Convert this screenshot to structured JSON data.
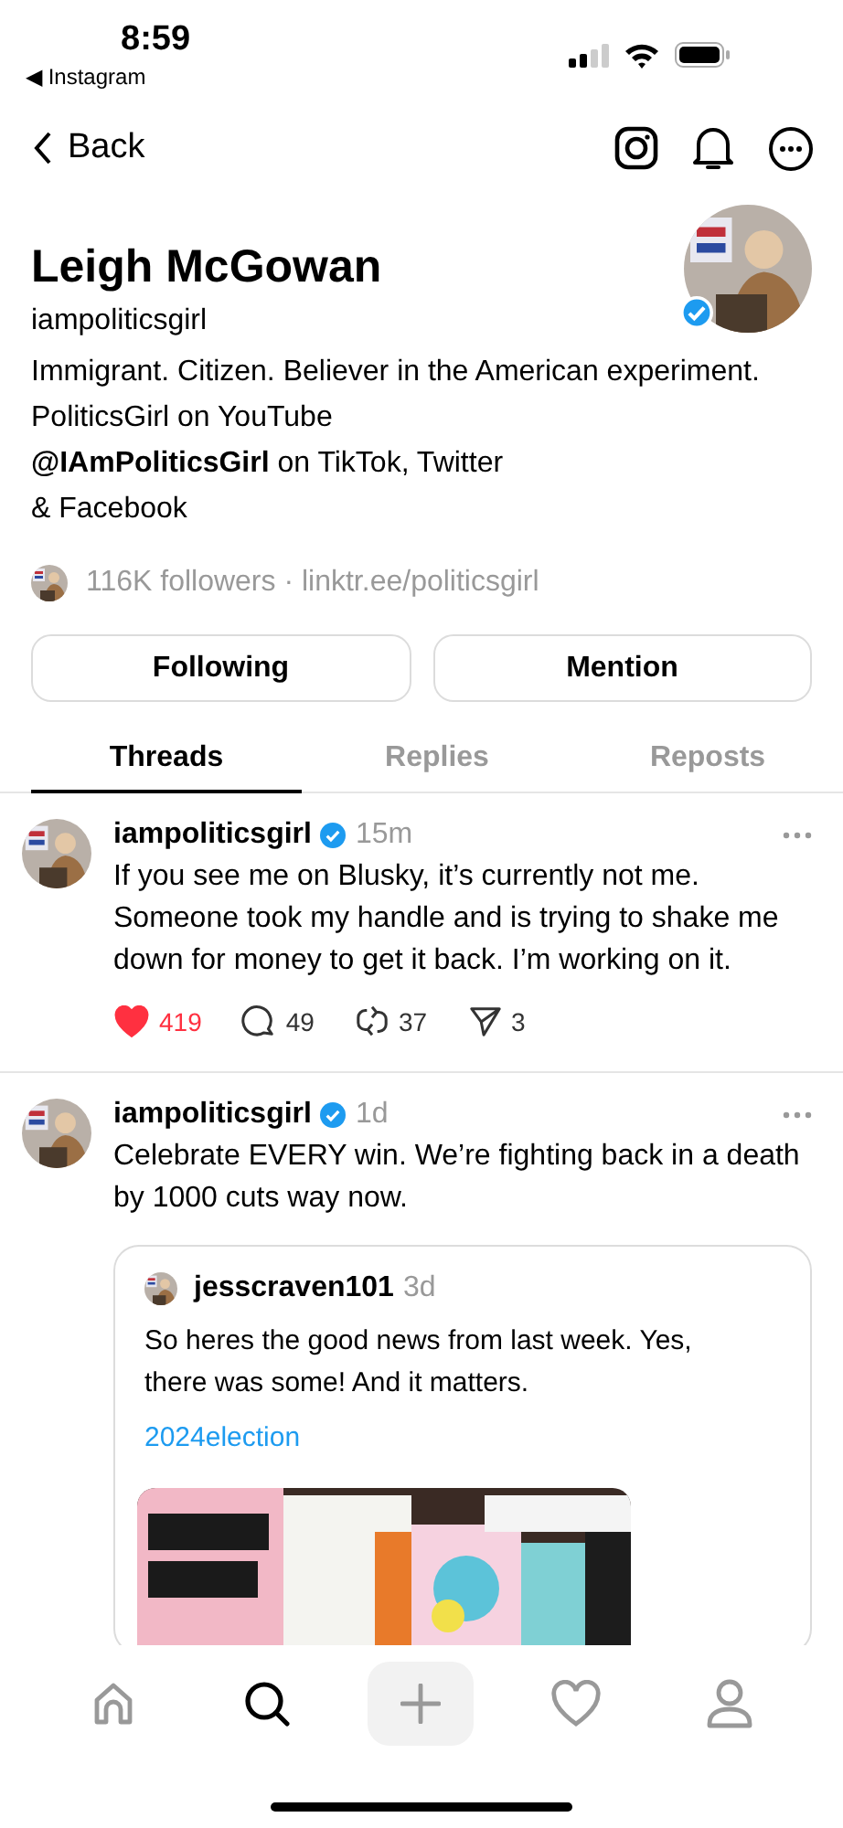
{
  "status_bar": {
    "time": "8:59",
    "back_app": "◀ Instagram"
  },
  "header": {
    "back": "Back"
  },
  "profile": {
    "name": "Leigh McGowan",
    "handle": "iampoliticsgirl",
    "verified": true,
    "bio": "Immigrant. Citizen. Believer in the American experiment.\nPoliticsGirl on YouTube\n**@IAmPoliticsGirl** on TikTok, Twitter\n& Facebook",
    "followers": "116K followers · linktr.ee/politicsgirl",
    "buttons": [
      "Following",
      "Mention"
    ]
  },
  "tabs": [
    {
      "label": "Threads",
      "selected": true
    },
    {
      "label": "Replies",
      "selected": false
    },
    {
      "label": "Reposts",
      "selected": false
    }
  ],
  "posts": [
    {
      "author": "iampoliticsgirl",
      "verified": true,
      "time": "15m",
      "text": "If you see me on Blusky, it’s currently not me. Someone took my handle and is trying to shake me down for money to get it back. I’m working on it.",
      "likes": "419",
      "liked": true,
      "replies": "49",
      "reposts": "37",
      "shares": "3"
    },
    {
      "author": "iampoliticsgirl",
      "verified": true,
      "time": "1d",
      "text": "Celebrate EVERY win. We’re fighting back in a death by 1000 cuts way now.",
      "quote": {
        "author": "jesscraven101",
        "time": "3d",
        "text": "So heres the good news from last week. Yes, there was some! And it matters.",
        "tag": "2024election"
      }
    }
  ],
  "nav": [
    {
      "kind": "home",
      "selected": false
    },
    {
      "kind": "search",
      "selected": true
    },
    {
      "kind": "create",
      "selected": false
    },
    {
      "kind": "activity",
      "selected": false
    },
    {
      "kind": "profile",
      "selected": false
    }
  ]
}
